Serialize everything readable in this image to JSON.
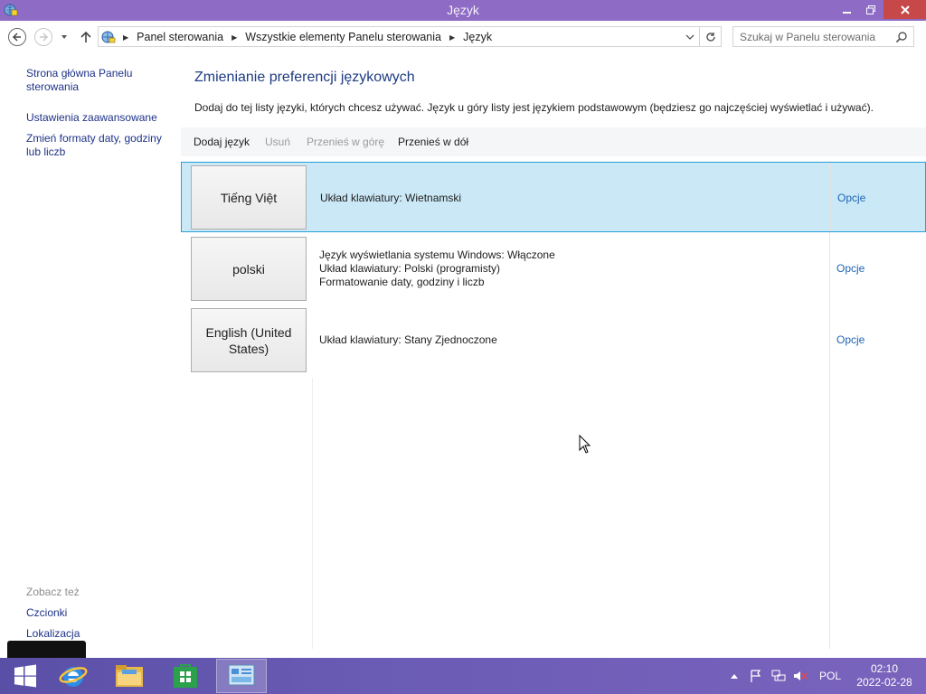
{
  "window": {
    "title": "Język"
  },
  "address": {
    "crumbs": [
      "Panel sterowania",
      "Wszystkie elementy Panelu sterowania",
      "Język"
    ],
    "search_placeholder": "Szukaj w Panelu sterowania"
  },
  "sidebar": {
    "links": [
      "Strona główna Panelu sterowania",
      "Ustawienia zaawansowane",
      "Zmień formaty daty, godziny lub liczb"
    ],
    "see_also_title": "Zobacz też",
    "see_also": [
      "Czcionki",
      "Lokalizacja"
    ]
  },
  "main": {
    "heading": "Zmienianie preferencji językowych",
    "description": "Dodaj do tej listy języki, których chcesz używać. Język u góry listy jest językiem podstawowym (będziesz go najczęściej wyświetlać i używać).",
    "toolbar": {
      "add": "Dodaj język",
      "remove": "Usuń",
      "move_up": "Przenieś w górę",
      "move_down": "Przenieś w dół"
    },
    "languages": [
      {
        "name": "Tiếng Việt",
        "details": [
          "Układ klawiatury: Wietnamski"
        ],
        "options": "Opcje"
      },
      {
        "name": "polski",
        "details": [
          "Język wyświetlania systemu Windows: Włączone",
          "Układ klawiatury: Polski (programisty)",
          "Formatowanie daty, godziny i liczb"
        ],
        "options": "Opcje"
      },
      {
        "name": "English (United States)",
        "details": [
          "Układ klawiatury: Stany Zjednoczone"
        ],
        "options": "Opcje"
      }
    ]
  },
  "taskbar": {
    "language": "POL",
    "time": "02:10",
    "date": "2022-02-28"
  },
  "colors": {
    "titlebar": "#8e6bc4",
    "selection": "#cbe8f6",
    "link": "#1e3287",
    "heading": "#1e3c82"
  }
}
